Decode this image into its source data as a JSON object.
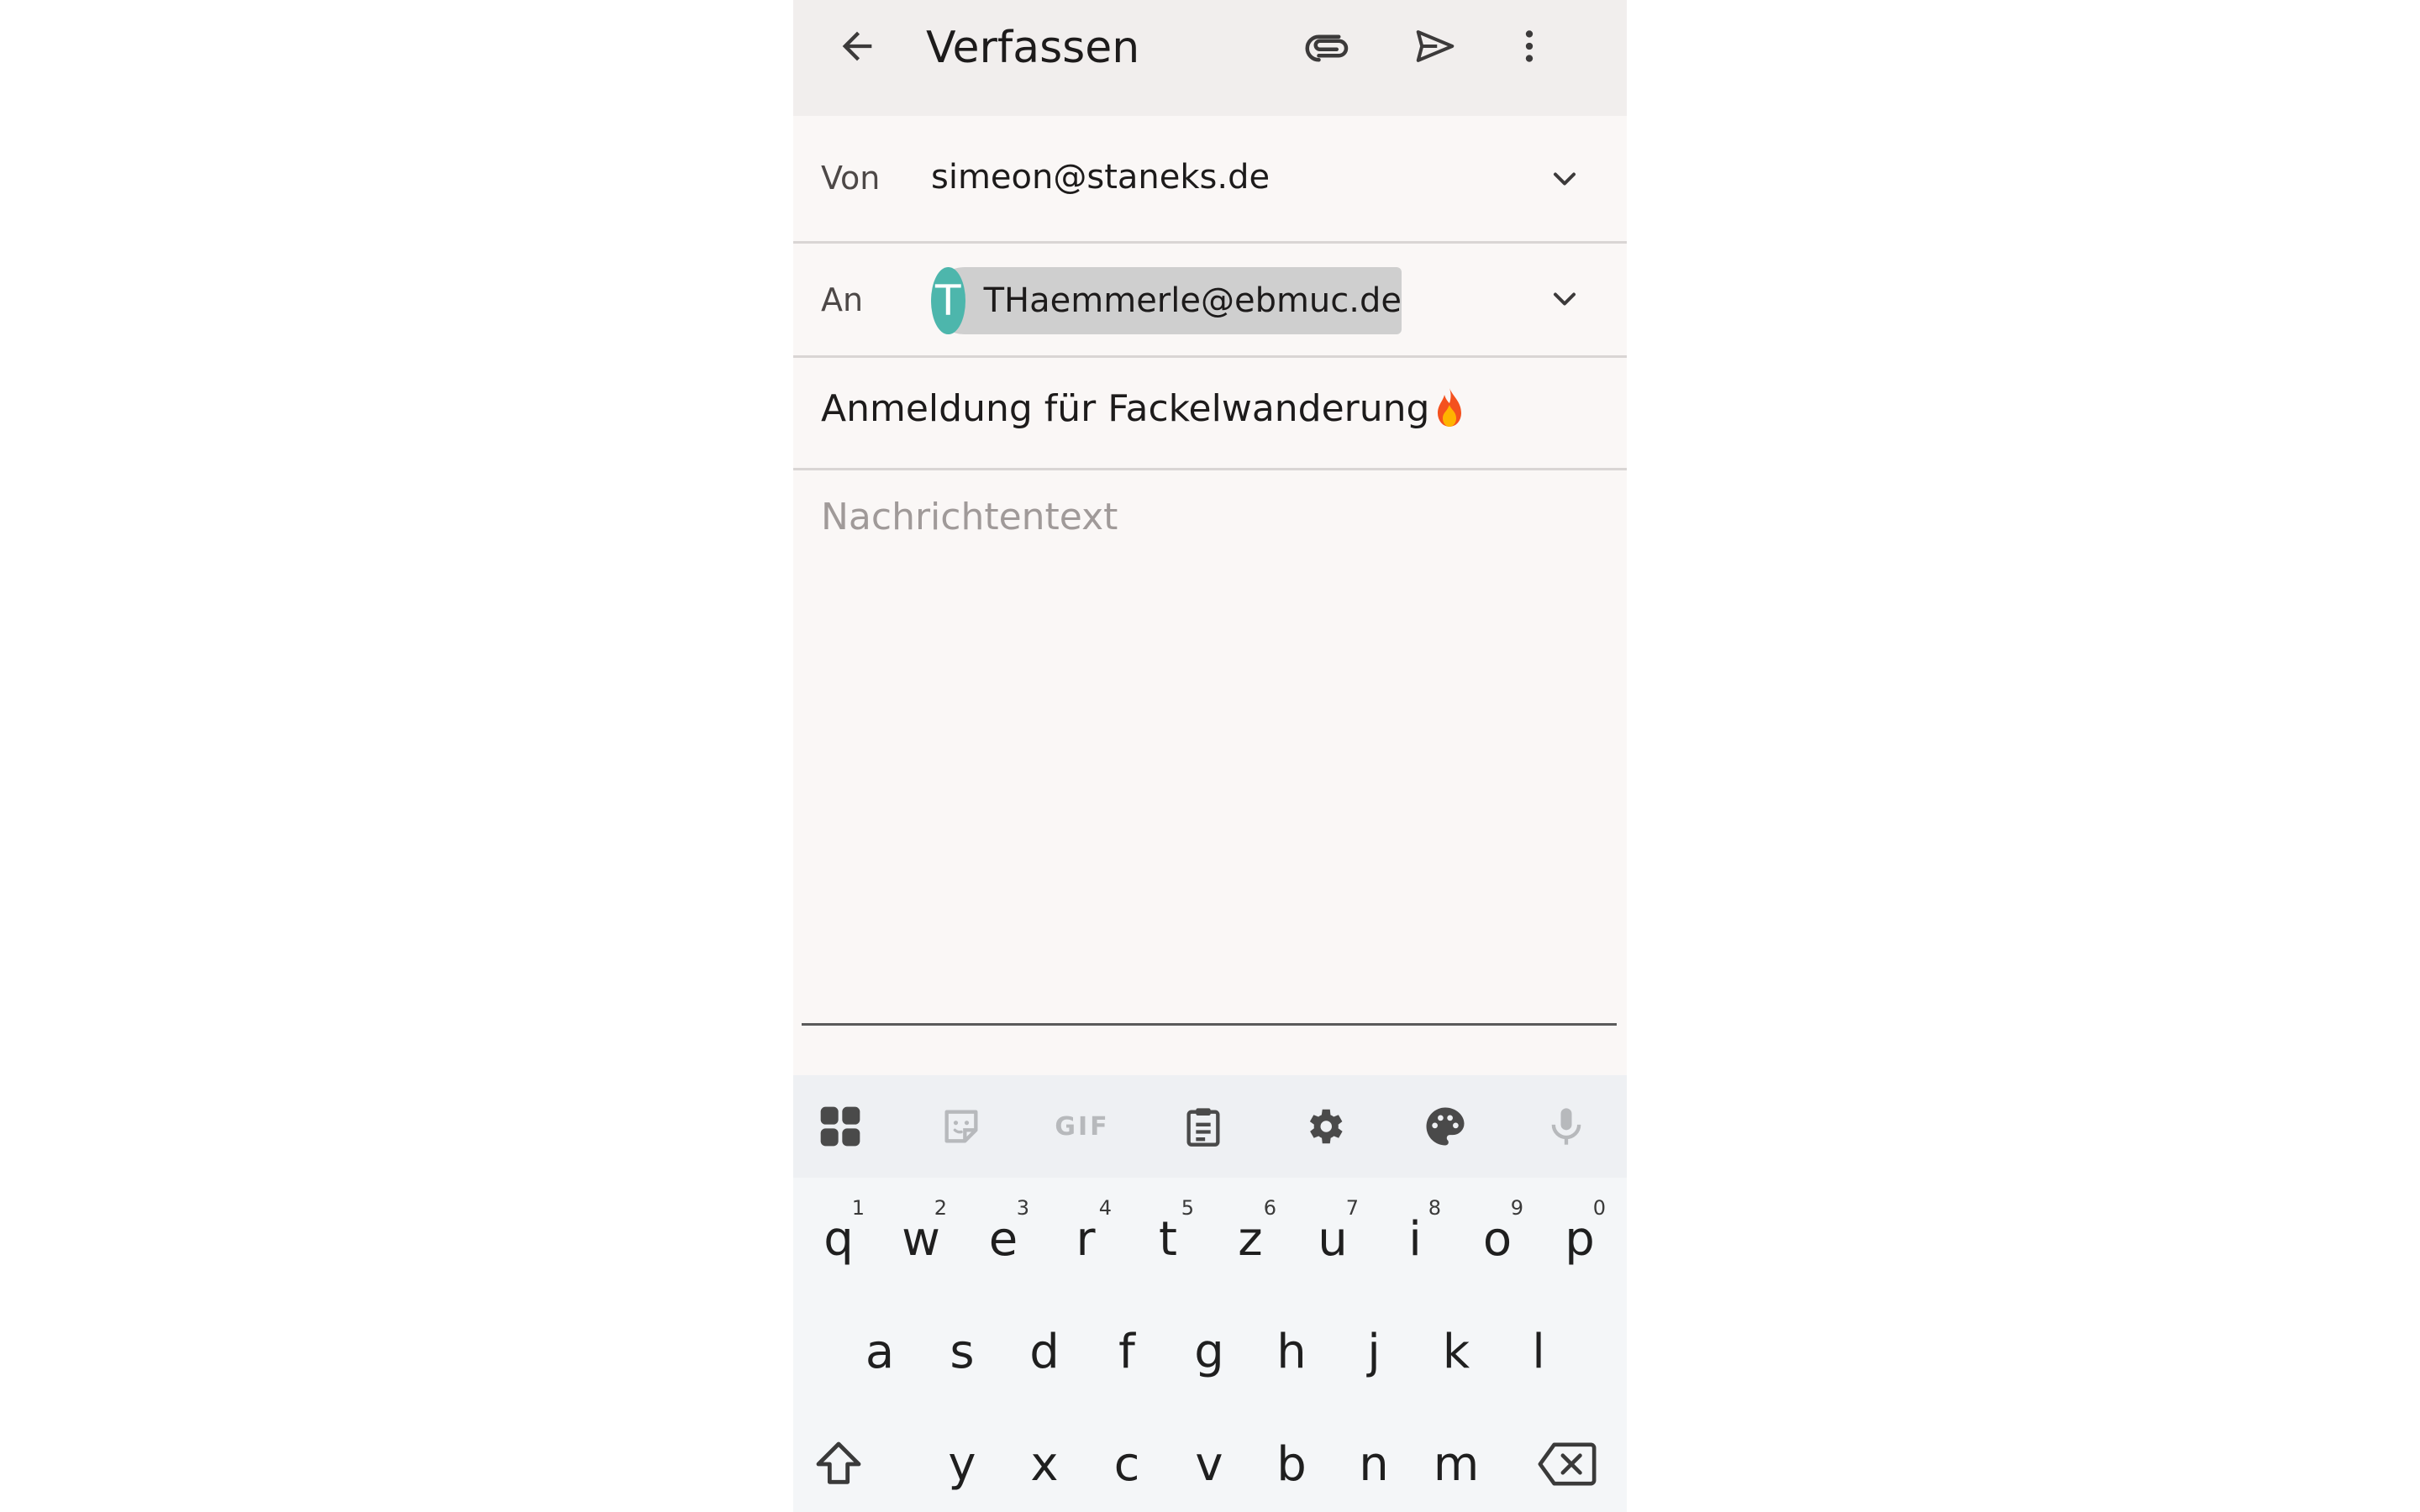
{
  "appbar": {
    "title": "Verfassen",
    "back_icon": "arrow-left-icon",
    "attach_icon": "paperclip-icon",
    "send_icon": "send-icon",
    "more_icon": "more-vert-icon"
  },
  "from": {
    "label": "Von",
    "value": "simeon@staneks.de"
  },
  "to": {
    "label": "An",
    "avatar_letter": "T",
    "avatar_color": "#4db6ac",
    "recipient": "THaemmerle@ebmuc.de"
  },
  "subject": {
    "text": "Anmeldung für Fackelwanderung",
    "emoji": "🔥"
  },
  "body": {
    "placeholder": "Nachrichtentext"
  },
  "keyboard": {
    "toolbar": {
      "items": [
        "apps-grid-icon",
        "sticker-icon",
        "gif-icon",
        "clipboard-icon",
        "settings-icon",
        "palette-icon",
        "mic-icon"
      ],
      "gif_label": "GIF"
    },
    "row1": [
      {
        "key": "q",
        "hint": "1"
      },
      {
        "key": "w",
        "hint": "2"
      },
      {
        "key": "e",
        "hint": "3"
      },
      {
        "key": "r",
        "hint": "4"
      },
      {
        "key": "t",
        "hint": "5"
      },
      {
        "key": "z",
        "hint": "6"
      },
      {
        "key": "u",
        "hint": "7"
      },
      {
        "key": "i",
        "hint": "8"
      },
      {
        "key": "o",
        "hint": "9"
      },
      {
        "key": "p",
        "hint": "0"
      }
    ],
    "row2": [
      "a",
      "s",
      "d",
      "f",
      "g",
      "h",
      "j",
      "k",
      "l"
    ],
    "row3": [
      "y",
      "x",
      "c",
      "v",
      "b",
      "n",
      "m"
    ]
  }
}
